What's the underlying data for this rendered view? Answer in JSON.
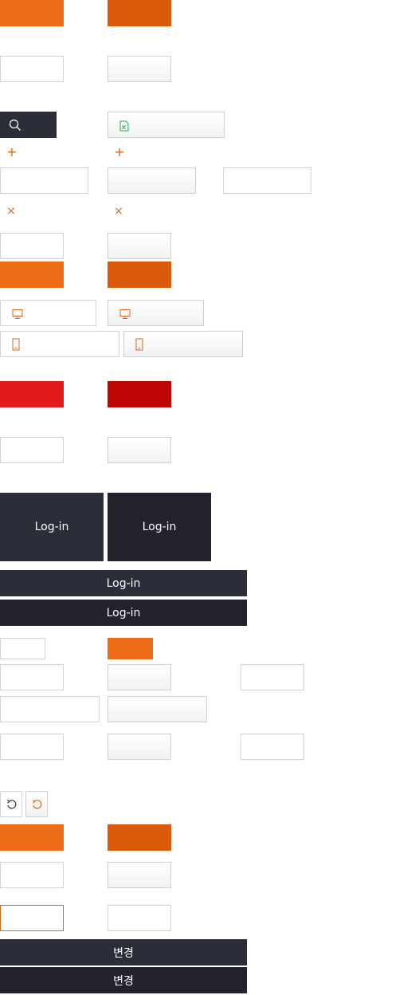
{
  "colors": {
    "orange": "#ed6a17",
    "orange_dark": "#d95a09",
    "red": "#e11b1b",
    "red_dark": "#bd0506",
    "navy": "#2b2e38",
    "navy_dark": "#22232c",
    "green_icon": "#2ea34b"
  },
  "icons": {
    "search": "search-icon",
    "excel": "excel-file-icon",
    "plus": "plus-icon",
    "close": "close-icon",
    "monitor": "monitor-icon",
    "mobile": "mobile-icon",
    "refresh": "refresh-icon"
  },
  "login": {
    "label": "Log-in"
  },
  "change": {
    "label": "변경"
  },
  "glyphs": {
    "plus": "+",
    "close": "×"
  }
}
